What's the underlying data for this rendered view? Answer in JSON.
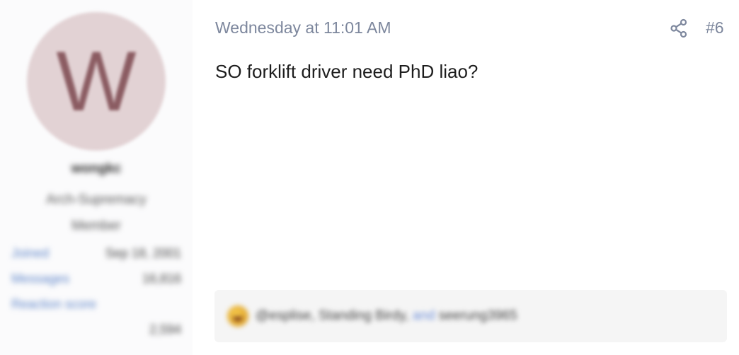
{
  "user": {
    "avatar_letter": "W",
    "username": "wongkc",
    "title": "Arch-Supremacy Member",
    "stats": [
      {
        "label": "Joined",
        "value": "Sep 18, 2001"
      },
      {
        "label": "Messages",
        "value": "16,816"
      },
      {
        "label": "Reaction score",
        "value": ""
      }
    ],
    "extra_value": "2,594"
  },
  "post": {
    "date": "Wednesday at 11:01 AM",
    "share_icon": "share-icon",
    "number": "#6",
    "message": "SO forklift driver need PhD liao?"
  },
  "reactions": {
    "emoji_icon": "laughing-emoji-icon",
    "names_before": "@esplise, Standing Birdy,",
    "names_link": "and",
    "names_after": "seerung3965"
  },
  "colors": {
    "meta_text": "#7d879d",
    "link": "#5d84c8",
    "avatar_bg": "#e2d2d4",
    "reaction_bg": "#f5f5f5"
  }
}
